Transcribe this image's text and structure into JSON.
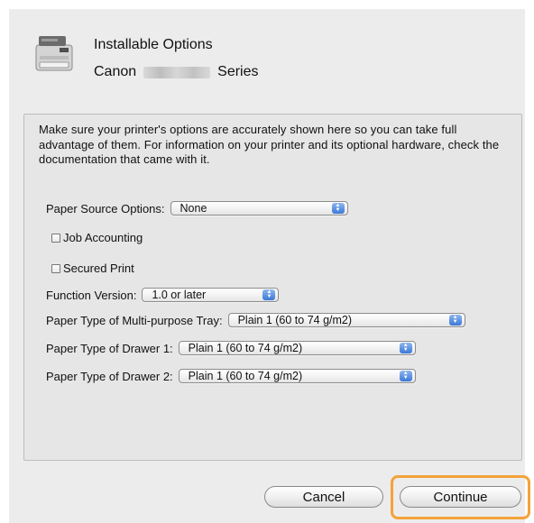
{
  "header": {
    "title": "Installable Options",
    "model_prefix": "Canon",
    "model_suffix": "Series"
  },
  "panel": {
    "description": "Make sure your printer's options are accurately shown here so you can take full advantage of them.  For information on your printer and its optional hardware, check the documentation that came with it.",
    "paper_source": {
      "label": "Paper Source Options:",
      "value": "None"
    },
    "job_accounting": {
      "label": "Job Accounting",
      "checked": false
    },
    "secured_print": {
      "label": "Secured Print",
      "checked": false
    },
    "function_version": {
      "label": "Function Version:",
      "value": "1.0 or later"
    },
    "multi_purpose_tray": {
      "label": "Paper Type of Multi-purpose Tray:",
      "value": "Plain 1 (60 to 74 g/m2)"
    },
    "drawer1": {
      "label": "Paper Type of Drawer 1:",
      "value": "Plain 1 (60 to 74 g/m2)"
    },
    "drawer2": {
      "label": "Paper Type of Drawer 2:",
      "value": "Plain 1 (60 to 74 g/m2)"
    }
  },
  "buttons": {
    "cancel": "Cancel",
    "continue": "Continue"
  },
  "colors": {
    "focus_ring": "#f3a33a",
    "popup_arrow": "#3a78d8"
  }
}
